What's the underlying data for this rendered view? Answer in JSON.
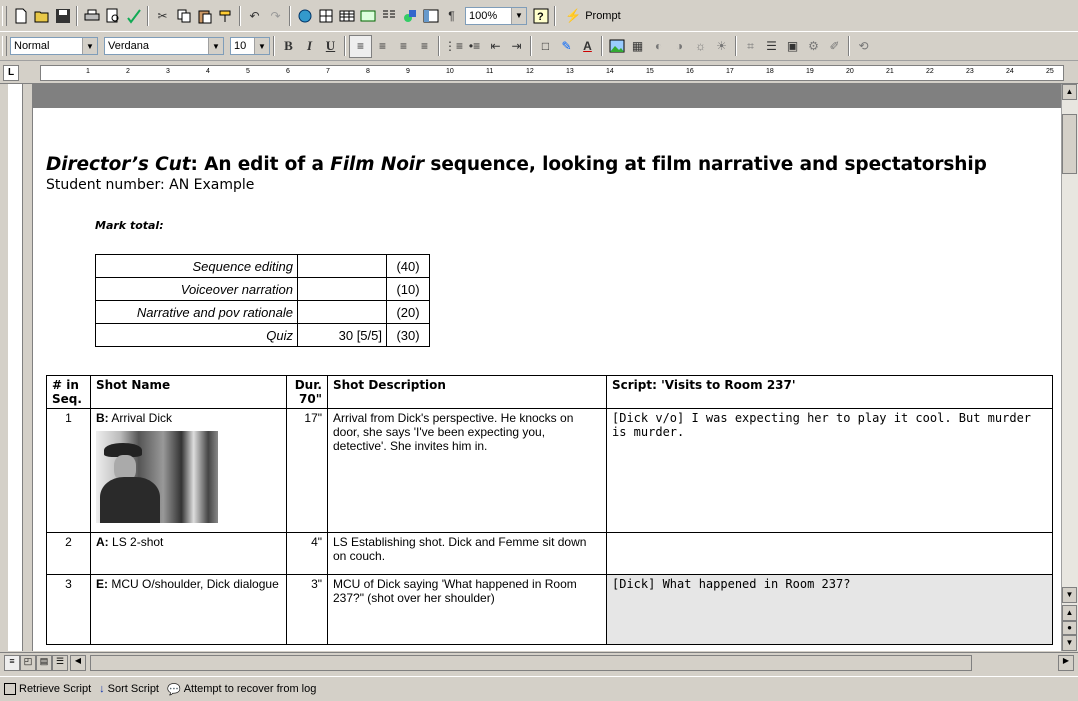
{
  "toolbar1": {
    "zoom": "100%",
    "prompt_label": "Prompt"
  },
  "toolbar2": {
    "style": "Normal",
    "font": "Verdana",
    "size": "10",
    "bold": "B",
    "italic": "I",
    "underline": "U"
  },
  "ruler": {
    "labels": [
      "1",
      "2",
      "3",
      "4",
      "5",
      "6",
      "7",
      "8",
      "9",
      "10",
      "11",
      "12",
      "13",
      "14",
      "15",
      "16",
      "17",
      "18",
      "19",
      "20",
      "21",
      "22",
      "23",
      "24",
      "25"
    ]
  },
  "doc": {
    "title_part1": "Director’s Cut",
    "title_part2": ": An edit of a ",
    "title_part3": "Film Noir",
    "title_part4": " sequence, looking at film narrative and spectatorship",
    "student": "Student number: AN Example",
    "mark_total": "Mark total:",
    "marks": [
      {
        "label": "Sequence editing",
        "mark": "",
        "max": "(40)"
      },
      {
        "label": "Voiceover narration",
        "mark": "",
        "max": "(10)"
      },
      {
        "label": "Narrative and pov rationale",
        "mark": "",
        "max": "(20)"
      },
      {
        "label": "Quiz",
        "mark": "30 [5/5]",
        "max": "(30)"
      }
    ],
    "table_headers": {
      "seq": "# in Seq.",
      "name": "Shot Name",
      "dur": "Dur. 70\"",
      "desc": "Shot Description",
      "script": "Script: 'Visits to Room 237'"
    },
    "rows": [
      {
        "num": "1",
        "code": "B:",
        "name": "Arrival Dick",
        "dur": "17\"",
        "desc": "Arrival from Dick's perspective. He knocks on door, she says 'I've been expecting you, detective'. She invites him in.",
        "script": "[Dick v/o] I was expecting her to play it cool. But murder is murder."
      },
      {
        "num": "2",
        "code": "A:",
        "name": "LS 2-shot",
        "dur": "4\"",
        "desc": "LS Establishing shot. Dick and Femme sit down on couch.",
        "script": ""
      },
      {
        "num": "3",
        "code": "E:",
        "name": "MCU O/shoulder, Dick dialogue",
        "dur": "3\"",
        "desc": "MCU of Dick saying 'What happened in Room 237?\" (shot over her shoulder)",
        "script": "[Dick] What happened in Room 237?"
      }
    ]
  },
  "status": {
    "retrieve": "Retrieve Script",
    "sort": "Sort Script",
    "recover": "Attempt to recover from log"
  }
}
